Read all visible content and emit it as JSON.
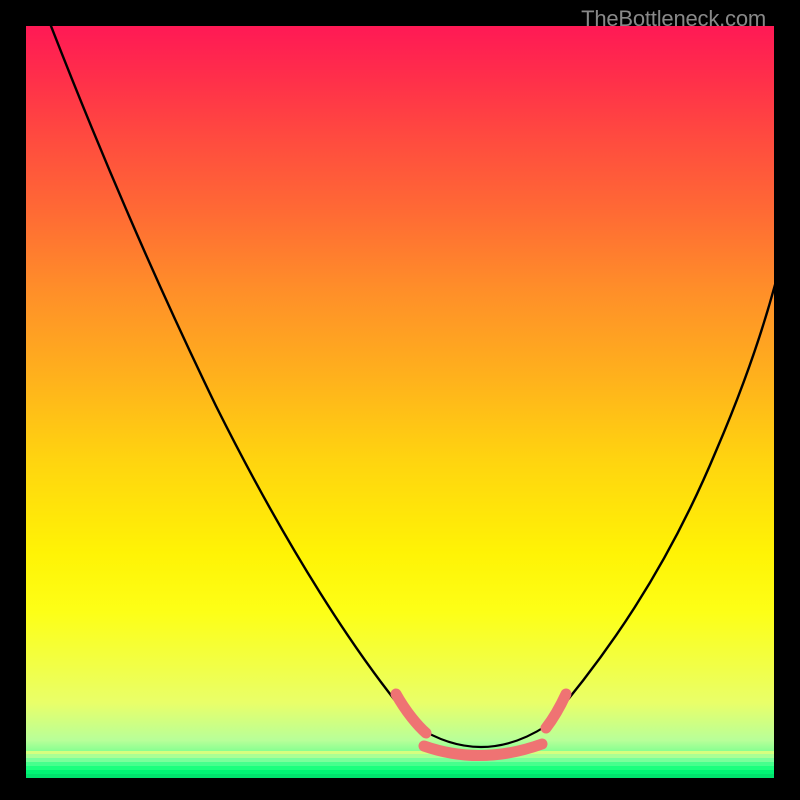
{
  "watermark": "TheBottleneck.com",
  "colors": {
    "background": "#000000",
    "curve": "#000000",
    "highlight": "#ef7373",
    "watermark": "#888888",
    "gradient_top": "#ff1955",
    "gradient_mid": "#ffd50f",
    "gradient_bottom": "#00e36d"
  },
  "chart_data": {
    "type": "line",
    "title": "",
    "xlabel": "",
    "ylabel": "",
    "xlim": [
      0,
      100
    ],
    "ylim": [
      0,
      100
    ],
    "grid": false,
    "legend": false,
    "series": [
      {
        "name": "bottleneck-curve",
        "x": [
          2,
          8,
          14,
          20,
          26,
          32,
          38,
          44,
          50,
          54,
          58,
          62,
          66,
          70,
          74,
          80,
          86,
          92,
          98,
          100
        ],
        "values": [
          102,
          90,
          78,
          66,
          54,
          43,
          33,
          24,
          15,
          9,
          4,
          1,
          1,
          4,
          9,
          18,
          30,
          45,
          60,
          66
        ]
      },
      {
        "name": "highlight-region",
        "x": [
          50,
          54,
          58,
          62,
          66,
          70,
          72
        ],
        "values": [
          11,
          6,
          2,
          1,
          2,
          5,
          8
        ]
      }
    ],
    "annotations": []
  }
}
